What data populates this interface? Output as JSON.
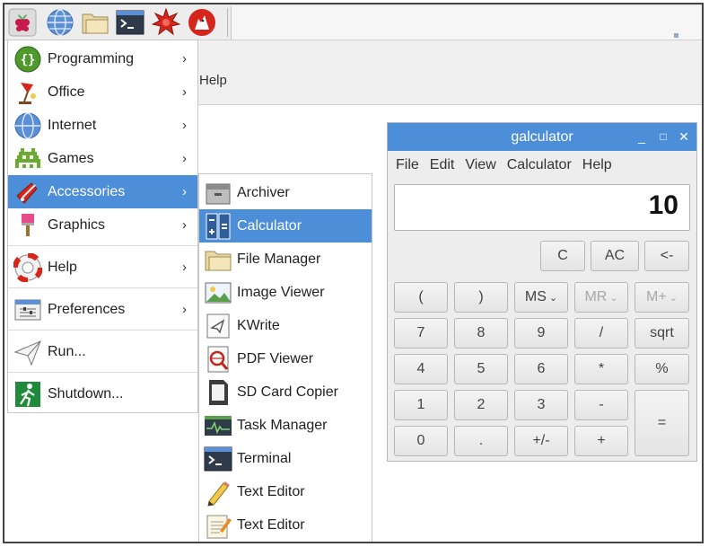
{
  "taskbar": {
    "icons": [
      "raspberry-menu-icon",
      "web-browser-icon",
      "file-manager-icon",
      "terminal-icon",
      "mathematica-icon",
      "wolfram-icon"
    ]
  },
  "background_window": {
    "menu_help": "Help"
  },
  "main_menu": {
    "items": [
      {
        "label": "Programming",
        "icon": "programming-icon",
        "arrow": "›"
      },
      {
        "label": "Office",
        "icon": "office-icon",
        "arrow": "›"
      },
      {
        "label": "Internet",
        "icon": "internet-icon",
        "arrow": "›"
      },
      {
        "label": "Games",
        "icon": "games-icon",
        "arrow": "›"
      },
      {
        "label": "Accessories",
        "icon": "accessories-icon",
        "arrow": "›",
        "selected": true
      },
      {
        "label": "Graphics",
        "icon": "graphics-icon",
        "arrow": "›"
      },
      {
        "label": "Help",
        "icon": "help-icon",
        "arrow": "›"
      },
      {
        "label": "Preferences",
        "icon": "preferences-icon",
        "arrow": "›"
      },
      {
        "label": "Run...",
        "icon": "run-icon",
        "arrow": ""
      },
      {
        "label": "Shutdown...",
        "icon": "shutdown-icon",
        "arrow": ""
      }
    ]
  },
  "accessories_submenu": {
    "items": [
      {
        "label": "Archiver",
        "icon": "archiver-icon"
      },
      {
        "label": "Calculator",
        "icon": "calculator-icon",
        "selected": true
      },
      {
        "label": "File Manager",
        "icon": "file-manager-icon"
      },
      {
        "label": "Image Viewer",
        "icon": "image-viewer-icon"
      },
      {
        "label": "KWrite",
        "icon": "kwrite-icon"
      },
      {
        "label": "PDF Viewer",
        "icon": "pdf-viewer-icon"
      },
      {
        "label": "SD Card Copier",
        "icon": "sd-card-icon"
      },
      {
        "label": "Task Manager",
        "icon": "task-manager-icon"
      },
      {
        "label": "Terminal",
        "icon": "terminal-icon"
      },
      {
        "label": "Text Editor",
        "icon": "text-editor-pencil-icon"
      },
      {
        "label": "Text Editor",
        "icon": "text-editor-notepad-icon"
      }
    ]
  },
  "calculator": {
    "title": "galculator",
    "window_buttons": {
      "minimize": "_",
      "maximize": "□",
      "close": "✕"
    },
    "menu": [
      "File",
      "Edit",
      "View",
      "Calculator",
      "Help"
    ],
    "display_value": "10",
    "keys": {
      "c": "C",
      "ac": "AC",
      "backspace": "<-",
      "open_paren": "(",
      "close_paren": ")",
      "ms": "MS",
      "mr": "MR",
      "mplus": "M+",
      "seven": "7",
      "eight": "8",
      "nine": "9",
      "divide": "/",
      "sqrt": "sqrt",
      "four": "4",
      "five": "5",
      "six": "6",
      "multiply": "*",
      "percent": "%",
      "one": "1",
      "two": "2",
      "three": "3",
      "minus": "-",
      "equals": "=",
      "zero": "0",
      "point": ".",
      "sign": "+/-",
      "plus": "+"
    },
    "dropdown_glyph": "⌄"
  },
  "colors": {
    "selection": "#4c8ed8",
    "titlebar": "#4c8ed8"
  }
}
